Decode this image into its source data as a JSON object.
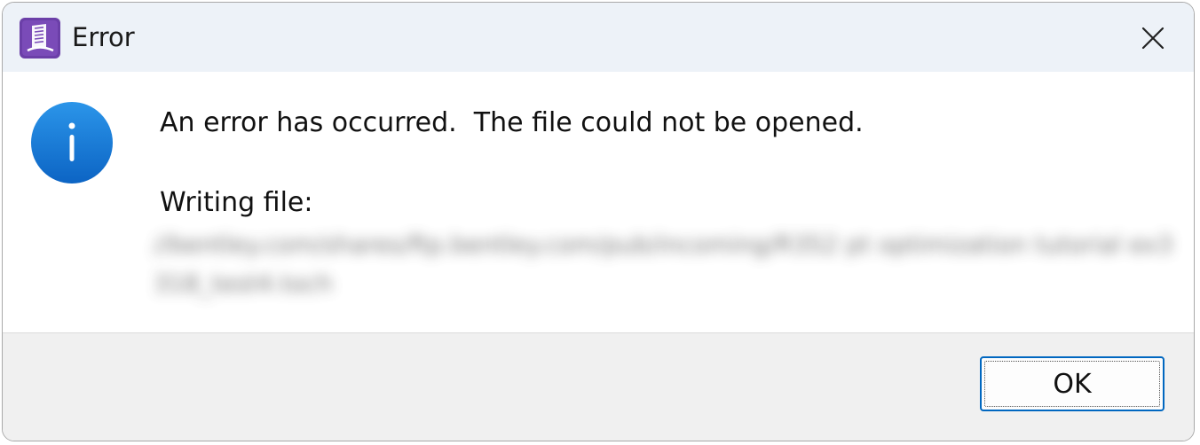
{
  "window": {
    "title": "Error",
    "app_icon": "book-building-icon",
    "close_icon": "close-icon"
  },
  "content": {
    "icon": "info-icon",
    "message": "An error has occurred.  The file could not be opened.",
    "detail_label": "Writing file:",
    "detail_path": "//bentley.com/shares/ftp.bentley.com/pub/incoming/R352 pt optimization tutorial ex3318_test4.toch"
  },
  "footer": {
    "ok_label": "OK"
  },
  "colors": {
    "titlebar": "#edf2f8",
    "app_icon_bg": "#6b3fa8",
    "info_blue": "#1e7fd6",
    "button_border": "#0067c0",
    "footer": "#f0f0f0"
  }
}
